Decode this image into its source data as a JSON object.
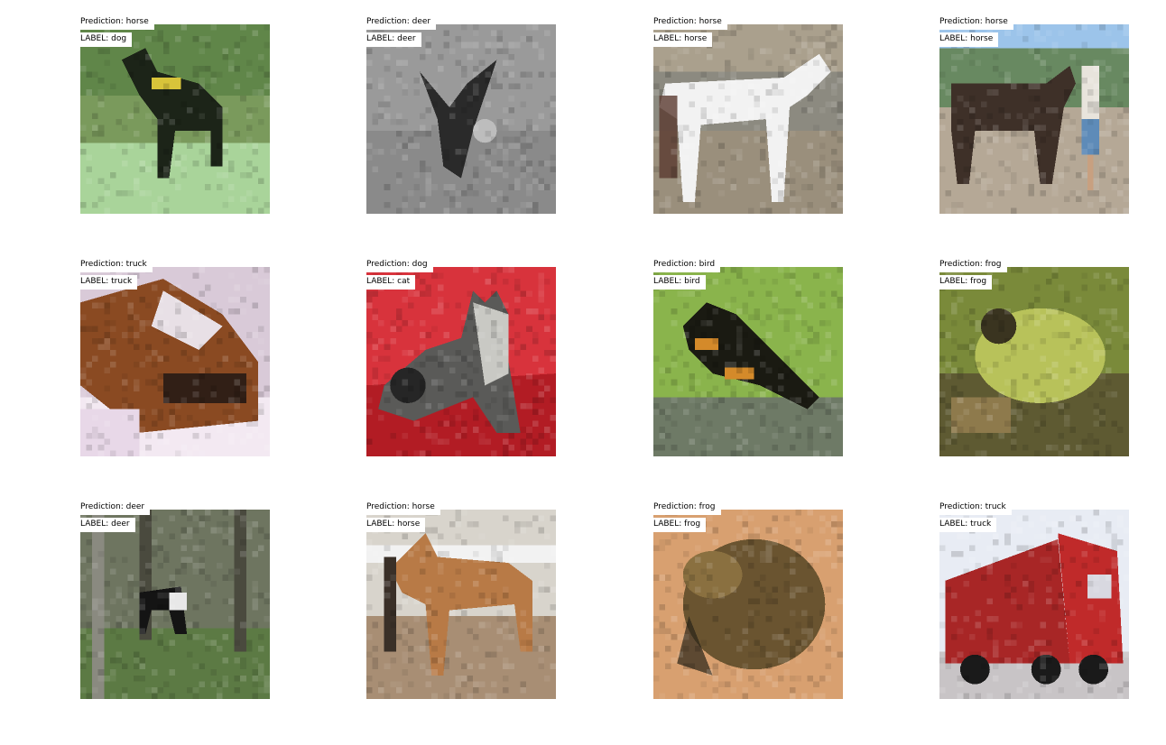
{
  "panels": [
    {
      "prediction": "Prediction: horse",
      "label": "LABEL: dog",
      "scene": "dog",
      "colors": {
        "sky": "#7a9a5c",
        "ground": "#a9d49a",
        "subject": "#1c2418",
        "accent": "#d8c43a",
        "foliage": "#4f7a3c"
      }
    },
    {
      "prediction": "Prediction: deer",
      "label": "LABEL: deer",
      "scene": "deer-gray",
      "colors": {
        "sky": "#9a9a9a",
        "ground": "#8a8a8a",
        "subject": "#2a2a2a",
        "accent": "#bdbdbd",
        "foliage": "#767676"
      }
    },
    {
      "prediction": "Prediction: horse",
      "label": "LABEL: horse",
      "scene": "horse-white",
      "colors": {
        "sky": "#8c8a80",
        "ground": "#9a8f7c",
        "subject": "#f2f2f2",
        "accent": "#5a3a30",
        "foliage": "#c8b59a"
      }
    },
    {
      "prediction": "Prediction: horse",
      "label": "LABEL: horse",
      "scene": "horse-man",
      "colors": {
        "sky": "#9cc4ea",
        "ground": "#b5a896",
        "subject": "#3e3028",
        "accent": "#5e8bb8",
        "foliage": "#5b7a3e"
      }
    },
    {
      "prediction": "Prediction: truck",
      "label": "LABEL: truck",
      "scene": "truck-brown",
      "colors": {
        "sky": "#d9cad8",
        "ground": "#f3e9f2",
        "subject": "#8a4a22",
        "accent": "#e8e0e6",
        "foliage": "#1a1414"
      }
    },
    {
      "prediction": "Prediction: dog",
      "label": "LABEL: cat",
      "scene": "cat-red",
      "colors": {
        "sky": "#d8333c",
        "ground": "#b21c24",
        "subject": "#5a5a58",
        "accent": "#c9c9c4",
        "foliage": "#262626"
      }
    },
    {
      "prediction": "Prediction: bird",
      "label": "LABEL: bird",
      "scene": "bird",
      "colors": {
        "sky": "#8ab44c",
        "ground": "#4f7a33",
        "subject": "#1a1a12",
        "accent": "#d48a2a",
        "foliage": "#6e7a66"
      }
    },
    {
      "prediction": "Prediction: frog",
      "label": "LABEL: frog",
      "scene": "frog-green",
      "colors": {
        "sky": "#7a8a3a",
        "ground": "#5e5a32",
        "subject": "#b8c25a",
        "accent": "#3a3420",
        "foliage": "#8e7a4c"
      }
    },
    {
      "prediction": "Prediction: deer",
      "label": "LABEL: deer",
      "scene": "deer-forest",
      "colors": {
        "sky": "#6e7560",
        "ground": "#5c7a44",
        "subject": "#141414",
        "accent": "#e8e8e8",
        "foliage": "#8a8a80"
      }
    },
    {
      "prediction": "Prediction: horse",
      "label": "LABEL: horse",
      "scene": "horse-brown",
      "colors": {
        "sky": "#d8d4cc",
        "ground": "#a88e74",
        "subject": "#b87a46",
        "accent": "#f2f2f2",
        "foliage": "#3a3028"
      }
    },
    {
      "prediction": "Prediction: frog",
      "label": "LABEL: frog",
      "scene": "frog-brown",
      "colors": {
        "sky": "#c89060",
        "ground": "#d8a070",
        "subject": "#6a5430",
        "accent": "#2a2418",
        "foliage": "#8a7040"
      }
    },
    {
      "prediction": "Prediction: truck",
      "label": "LABEL: truck",
      "scene": "truck-red",
      "colors": {
        "sky": "#e8ecf4",
        "ground": "#c8c4c6",
        "subject": "#a82626",
        "accent": "#1a1a1a",
        "foliage": "#d8d8e0"
      }
    }
  ]
}
